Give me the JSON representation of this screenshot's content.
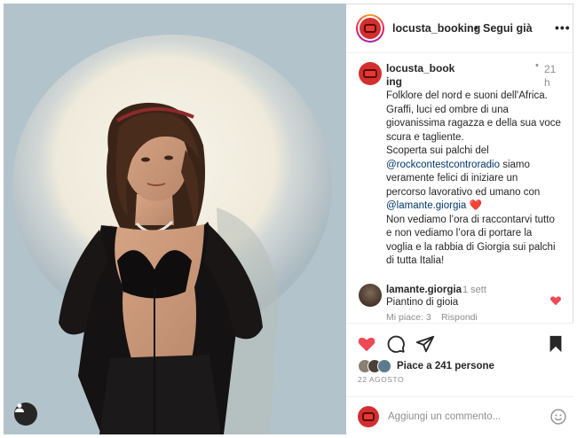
{
  "post": {
    "account": "locusta_booking",
    "follow_label": "Segui già",
    "separator": "•",
    "more_icon": "more-horizontal-icon"
  },
  "caption": {
    "username": "locusta_booking",
    "time": "21 h",
    "lines": [
      {
        "text": "Folklore del nord e suoni dell'Africa."
      },
      {
        "text": "Graffi, luci ed ombre di una"
      },
      {
        "text": "giovanissima ragazza e della sua voce"
      },
      {
        "text": "scura e tagliente."
      },
      {
        "text": "Scoperta sui palchi del"
      },
      {
        "mention": "@rockcontestcontroradio",
        "text": " siamo"
      },
      {
        "text": "veramente felici di iniziare un"
      },
      {
        "text": "percorso lavorativo ed umano con"
      },
      {
        "mention": "@lamante.giorgia",
        "heart": "❤️"
      },
      {
        "text": "Non vediamo l’ora di raccontarvi tutto"
      },
      {
        "text": "e non vediamo l’ora di portare la"
      },
      {
        "text": "voglia e la rabbia di Giorgia sui palchi"
      },
      {
        "text": "di tutta Italia!"
      }
    ]
  },
  "comment": {
    "username": "lamante.giorgia",
    "time": "1 sett",
    "text": "Piantino di gioia",
    "likes": "Mi piace: 3",
    "reply": "Rispondi"
  },
  "footer": {
    "likes_text": "Piace a 241 persone",
    "date": "22 AGOSTO",
    "comment_placeholder": "Aggiungi un commento..."
  },
  "colors": {
    "like_red": "#ed4956",
    "mention_blue": "#00376b",
    "muted_gray": "#8e8e8e",
    "brand_red": "#d32f2f"
  }
}
